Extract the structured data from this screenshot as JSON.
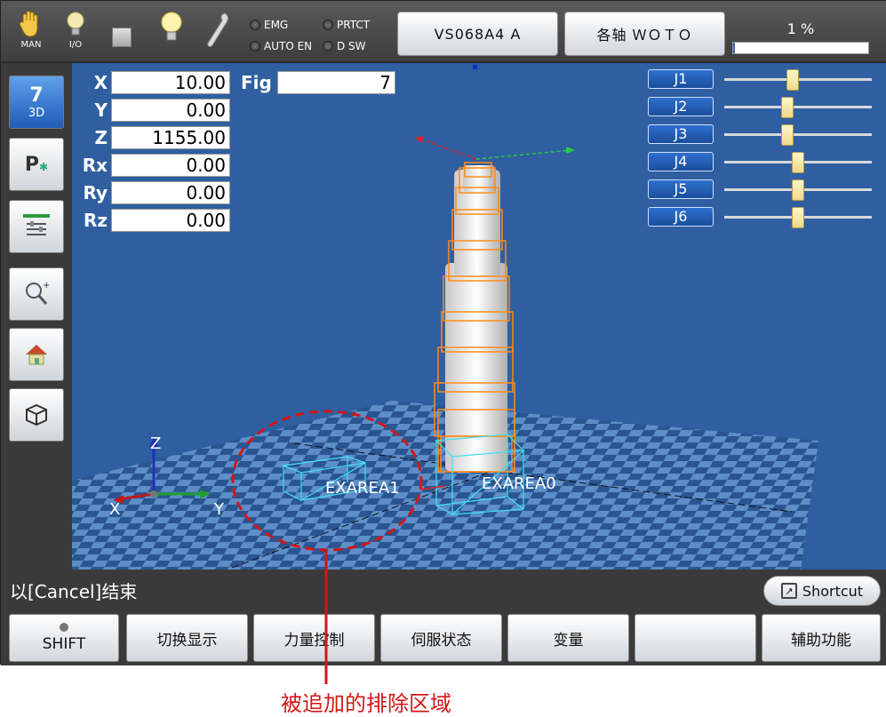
{
  "topbar": {
    "icons": [
      {
        "name": "hand-icon",
        "label": "MAN"
      },
      {
        "name": "io-bulb-icon",
        "label": "I/O"
      },
      {
        "name": "stop-square-icon",
        "label": ""
      },
      {
        "name": "light-bulb-icon",
        "label": ""
      },
      {
        "name": "wrench-icon",
        "label": ""
      }
    ],
    "lamps": {
      "emg": "EMG",
      "prtct": "PRTCT",
      "auto_en": "AUTO EN",
      "d_sw": "D SW"
    },
    "robot_button": "VS068A4 A",
    "mode_button": "各轴 ＷＯＴＯ",
    "speed_percent_label": "1 %",
    "speed_percent_value": 1
  },
  "sidebar": {
    "items": [
      {
        "name": "3d-view",
        "icon": "cube-7-icon",
        "label": "3D",
        "active": true
      },
      {
        "name": "position-add",
        "icon": "p-star-icon",
        "label": ""
      },
      {
        "name": "settings-panel",
        "icon": "sliders-icon",
        "label": ""
      },
      {
        "name": "zoom-search",
        "icon": "magnifier-plus-icon",
        "label": ""
      },
      {
        "name": "home",
        "icon": "home-icon",
        "label": ""
      },
      {
        "name": "box-view",
        "icon": "box-icon",
        "label": ""
      }
    ]
  },
  "viewport": {
    "coords": [
      {
        "label": "X",
        "value": "10.00"
      },
      {
        "label": "Y",
        "value": "0.00"
      },
      {
        "label": "Z",
        "value": "1155.00"
      },
      {
        "label": "Rx",
        "value": "0.00"
      },
      {
        "label": "Ry",
        "value": "0.00"
      },
      {
        "label": "Rz",
        "value": "0.00"
      }
    ],
    "fig_label": "Fig",
    "fig_value": "7",
    "joints": [
      {
        "label": "J1",
        "level": 0.46
      },
      {
        "label": "J2",
        "level": 0.42
      },
      {
        "label": "J3",
        "level": 0.42
      },
      {
        "label": "J4",
        "level": 0.5
      },
      {
        "label": "J5",
        "level": 0.5
      },
      {
        "label": "J6",
        "level": 0.5
      }
    ],
    "axis_labels": {
      "x": "X",
      "y": "Y",
      "z": "Z"
    },
    "areas": [
      "EXAREA1",
      "EXAREA0"
    ]
  },
  "status": {
    "message": "以[Cancel]结束",
    "shortcut_label": "Shortcut"
  },
  "function_keys": [
    {
      "name": "shift",
      "label": "SHIFT",
      "led": true
    },
    {
      "name": "switch-display",
      "label": "切换显示",
      "led": false
    },
    {
      "name": "force-control",
      "label": "力量控制",
      "led": false
    },
    {
      "name": "servo-status",
      "label": "伺服状态",
      "led": false
    },
    {
      "name": "variables",
      "label": "变量",
      "led": false
    },
    {
      "name": "empty",
      "label": "",
      "led": false
    },
    {
      "name": "aux-functions",
      "label": "辅助功能",
      "led": false
    }
  ],
  "callout": {
    "text": "被追加的排除区域",
    "color": "#d01818"
  },
  "colors": {
    "viewport_bg": "#2f5fa0",
    "accent_blue": "#1f5cb8",
    "robot_wire": "#ff8a1a",
    "area_cyan": "#40e0f0"
  }
}
